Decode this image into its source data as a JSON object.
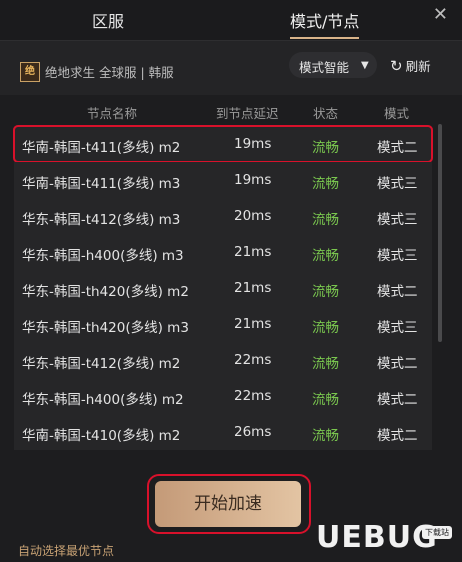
{
  "tabs": {
    "zone": "区服",
    "mode": "模式/节点"
  },
  "game": {
    "logo_text": "绝",
    "title": "绝地求生 全球服 | 韩服"
  },
  "mode_select": {
    "value": "模式智能"
  },
  "refresh_label": "刷新",
  "headers": {
    "name": "节点名称",
    "delay": "到节点延迟",
    "state": "状态",
    "mode": "模式"
  },
  "rows": [
    {
      "name": "华南-韩国-t411(多线) m2",
      "delay": "19ms",
      "state": "流畅",
      "mode": "模式二"
    },
    {
      "name": "华南-韩国-t411(多线) m3",
      "delay": "19ms",
      "state": "流畅",
      "mode": "模式三"
    },
    {
      "name": "华东-韩国-t412(多线) m3",
      "delay": "20ms",
      "state": "流畅",
      "mode": "模式三"
    },
    {
      "name": "华东-韩国-h400(多线) m3",
      "delay": "21ms",
      "state": "流畅",
      "mode": "模式三"
    },
    {
      "name": "华东-韩国-th420(多线) m2",
      "delay": "21ms",
      "state": "流畅",
      "mode": "模式二"
    },
    {
      "name": "华东-韩国-th420(多线) m3",
      "delay": "21ms",
      "state": "流畅",
      "mode": "模式三"
    },
    {
      "name": "华东-韩国-t412(多线) m2",
      "delay": "22ms",
      "state": "流畅",
      "mode": "模式二"
    },
    {
      "name": "华东-韩国-h400(多线) m2",
      "delay": "22ms",
      "state": "流畅",
      "mode": "模式二"
    },
    {
      "name": "华南-韩国-t410(多线) m2",
      "delay": "26ms",
      "state": "流畅",
      "mode": "模式二"
    }
  ],
  "start_button": "开始加速",
  "auto_tip": "自动选择最优节点",
  "watermark": {
    "text": "UEBUG",
    "badge": "下载站"
  },
  "colors": {
    "accent": "#d9b48a",
    "state_ok": "#7ac74f",
    "highlight": "#d8112b"
  }
}
